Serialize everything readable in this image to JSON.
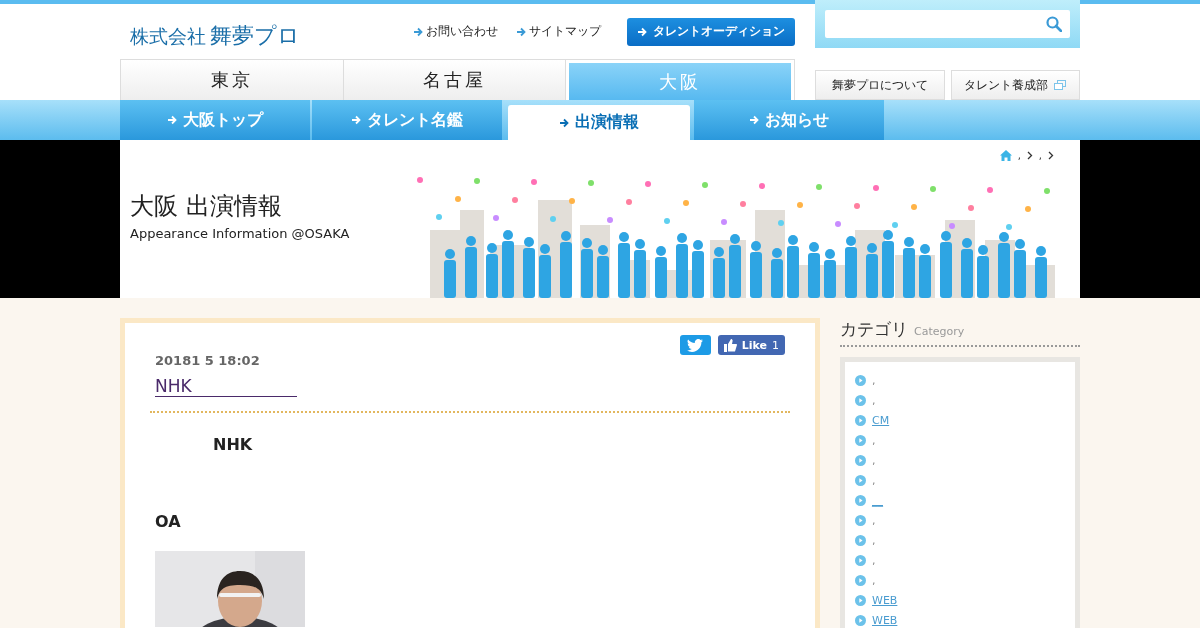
{
  "logo": {
    "company": "株式会社",
    "name": "舞夢プロ"
  },
  "header_links": [
    {
      "label": "お問い合わせ"
    },
    {
      "label": "サイトマップ"
    }
  ],
  "audition_button": {
    "label": "タレントオーディション"
  },
  "region_tabs": [
    {
      "label": "東京",
      "selected": false
    },
    {
      "label": "名古屋",
      "selected": false
    },
    {
      "label": "大阪",
      "selected": true
    }
  ],
  "side_buttons": [
    {
      "label": "舞夢プロについて",
      "external": false
    },
    {
      "label": "タレント養成部",
      "external": true
    }
  ],
  "subnav": [
    {
      "label": "大阪トップ",
      "selected": false
    },
    {
      "label": "タレント名鑑",
      "selected": false
    },
    {
      "label": "出演情報",
      "selected": true
    },
    {
      "label": "お知らせ",
      "selected": false
    }
  ],
  "breadcrumb": [
    {
      "label": ","
    },
    {
      "label": ","
    }
  ],
  "page_title": {
    "title": "大阪 出演情報",
    "subtitle": "Appearance Information @OSAKA"
  },
  "post": {
    "date": "20181 5 18:02",
    "title": "NHK",
    "like_label": "Like",
    "like_count": "1",
    "paragraphs": [
      {
        "kind": "indented",
        "text": "NHK"
      },
      {
        "kind": "plain",
        "text": "OA"
      }
    ]
  },
  "sidebar": {
    "heading": "カテゴリ",
    "subheading": "Category",
    "categories": [
      {
        "kind": "text",
        "label": ","
      },
      {
        "kind": "text",
        "label": ","
      },
      {
        "kind": "link",
        "label": "CM"
      },
      {
        "kind": "text",
        "label": ","
      },
      {
        "kind": "text",
        "label": ","
      },
      {
        "kind": "text",
        "label": ","
      },
      {
        "kind": "link",
        "label": "__"
      },
      {
        "kind": "text",
        "label": ","
      },
      {
        "kind": "text",
        "label": ","
      },
      {
        "kind": "text",
        "label": ","
      },
      {
        "kind": "text",
        "label": ","
      },
      {
        "kind": "link",
        "label": "WEB"
      },
      {
        "kind": "link",
        "label": "WEB"
      }
    ]
  }
}
